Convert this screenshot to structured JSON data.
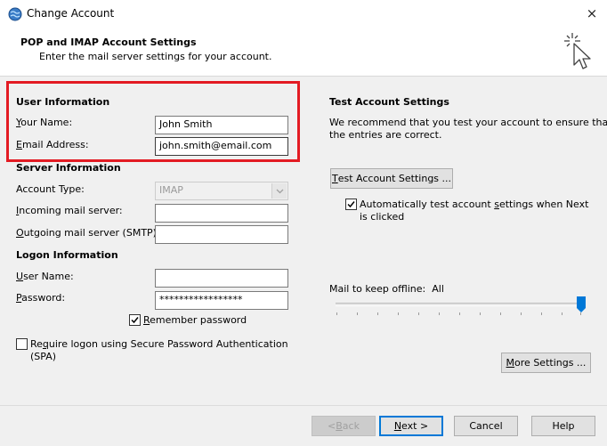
{
  "window": {
    "title": "Change Account",
    "close_icon": "×"
  },
  "header": {
    "title": "POP and IMAP Account Settings",
    "subtitle": "Enter the mail server settings for your account."
  },
  "user_info": {
    "section": "User Information",
    "name_label_u": "Y",
    "name_label_rest": "our Name:",
    "name_value": "John Smith",
    "email_label_u": "E",
    "email_label_rest": "mail Address:",
    "email_value": "john.smith@email.com"
  },
  "server_info": {
    "section": "Server Information",
    "account_type_label_pre": "Account Type:",
    "account_type_value": "IMAP",
    "incoming_label_u": "I",
    "incoming_label_rest": "ncoming mail server:",
    "incoming_value": "",
    "outgoing_label_u": "O",
    "outgoing_label_rest": "utgoing mail server (SMTP):",
    "outgoing_value": ""
  },
  "logon_info": {
    "section": "Logon Information",
    "username_label_u": "U",
    "username_label_rest": "ser Name:",
    "username_value": "",
    "password_label_u": "P",
    "password_label_rest": "assword:",
    "password_value": "*****************",
    "remember_label_u": "R",
    "remember_label_rest": "emember password",
    "remember_checked": true,
    "spa_label_pre": "Re",
    "spa_label_u": "q",
    "spa_label_rest": "uire logon using Secure Password Authentication",
    "spa_label_line2": "(SPA)",
    "spa_checked": false
  },
  "test_settings": {
    "section": "Test Account Settings",
    "description_line1": "We recommend that you test your account to ensure that",
    "description_line2": "the entries are correct.",
    "test_button_u": "T",
    "test_button_rest": "est Account Settings ...",
    "auto_test_line1_pre": "Automatically test account ",
    "auto_test_line1_u": "s",
    "auto_test_line1_rest": "ettings when Next",
    "auto_test_line2": "is clicked",
    "auto_test_checked": true
  },
  "offline": {
    "label": "Mail to keep offline:",
    "value": "All",
    "slider_level": 1.0
  },
  "more_settings": {
    "u": "M",
    "rest": "ore Settings ..."
  },
  "footer": {
    "back_pre": "< ",
    "back_u": "B",
    "back_rest": "ack",
    "next_u": "N",
    "next_rest": "ext >",
    "cancel": "Cancel",
    "help": "Help"
  },
  "colors": {
    "highlight": "#e31b23",
    "accent": "#0078d7"
  }
}
